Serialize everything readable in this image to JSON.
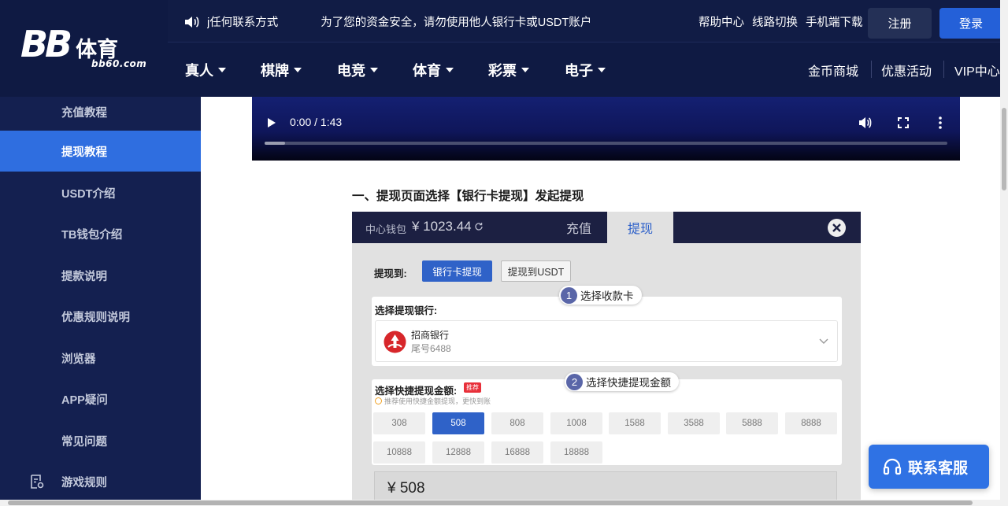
{
  "header": {
    "logo": {
      "main": "BB",
      "cn": "体育",
      "sub": "bb60.com"
    },
    "marquee": [
      "j任何联系方式",
      "为了您的资金安全，请勿使用他人银行卡或USDT账户"
    ],
    "links": [
      "帮助中心",
      "线路切换",
      "手机端下载"
    ],
    "register_label": "注册",
    "login_label": "登录",
    "nav": [
      "真人",
      "棋牌",
      "电竞",
      "体育",
      "彩票",
      "电子"
    ],
    "nav_right": [
      "金币商城",
      "优惠活动",
      "VIP中心"
    ]
  },
  "sidebar": {
    "items": [
      {
        "label": "充值教程"
      },
      {
        "label": "提现教程",
        "active": true
      },
      {
        "label": "USDT介绍"
      },
      {
        "label": "TB钱包介绍"
      },
      {
        "label": "提款说明"
      },
      {
        "label": "优惠规则说明"
      },
      {
        "label": "浏览器"
      },
      {
        "label": "APP疑问"
      },
      {
        "label": "常见问题"
      },
      {
        "label": "游戏规则"
      }
    ]
  },
  "video": {
    "time": "0:00 / 1:43",
    "progress": 0.03
  },
  "section_title": "一、提现页面选择【银行卡提现】发起提现",
  "screenshot": {
    "wallet_label": "中心钱包",
    "wallet_amount": "¥ 1023.44",
    "tabs": [
      "充值",
      "提现"
    ],
    "withdraw_to_label": "提现到:",
    "method_bank": "银行卡提现",
    "method_usdt": "提现到USDT",
    "step1": {
      "num": "1",
      "label": "选择收款卡"
    },
    "bank_section_title": "选择提现银行:",
    "bank_name": "招商银行",
    "bank_tail": "尾号6488",
    "step2": {
      "num": "2",
      "label": "选择快捷提现金额"
    },
    "quick_title": "选择快捷提现金额:",
    "recommend_badge": "推荐",
    "quick_hint": "推荐使用快捷金额提现，更快到账",
    "amounts": [
      "308",
      "508",
      "808",
      "1008",
      "1588",
      "3588",
      "5888",
      "8888",
      "10888",
      "12888",
      "16888",
      "18888"
    ],
    "selected_amount": "508",
    "amount_display": "¥  508"
  },
  "customer_service_label": "联系客服",
  "colors": {
    "navy": "#0f1a43",
    "sidebar": "#142050",
    "accent": "#2f6ee0"
  }
}
